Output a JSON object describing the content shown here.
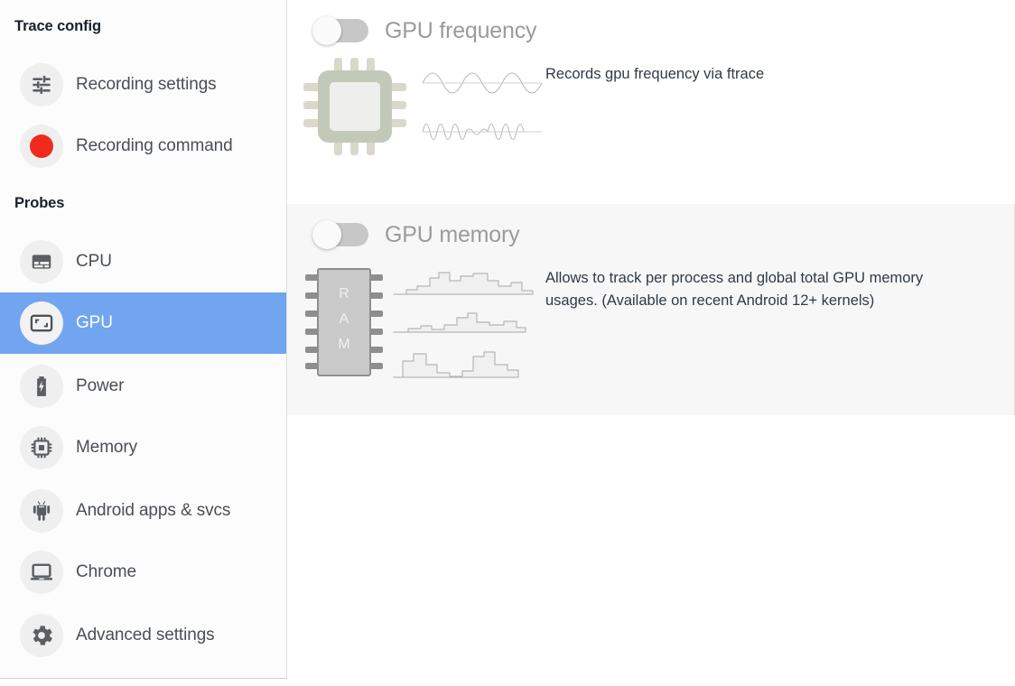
{
  "sidebar": {
    "headings": {
      "trace_config": "Trace config",
      "probes": "Probes"
    },
    "items": [
      {
        "label": "Recording settings",
        "icon": "tune-icon",
        "selected": false,
        "group": "trace"
      },
      {
        "label": "Recording command",
        "icon": "record-dot-icon",
        "selected": false,
        "group": "trace"
      },
      {
        "label": "CPU",
        "icon": "cpu-icon",
        "selected": false,
        "group": "probes"
      },
      {
        "label": "GPU",
        "icon": "gpu-icon",
        "selected": true,
        "group": "probes"
      },
      {
        "label": "Power",
        "icon": "battery-icon",
        "selected": false,
        "group": "probes"
      },
      {
        "label": "Memory",
        "icon": "memory-chip-icon",
        "selected": false,
        "group": "probes"
      },
      {
        "label": "Android apps & svcs",
        "icon": "android-icon",
        "selected": false,
        "group": "probes"
      },
      {
        "label": "Chrome",
        "icon": "laptop-icon",
        "selected": false,
        "group": "probes"
      },
      {
        "label": "Advanced settings",
        "icon": "gear-icon",
        "selected": false,
        "group": "probes"
      }
    ]
  },
  "main": {
    "probes": [
      {
        "title": "GPU frequency",
        "description": "Records gpu frequency via ftrace",
        "toggle_state": "off",
        "illustration": "cpu-chip-waveforms-illustration"
      },
      {
        "title": "GPU memory",
        "description": "Allows to track per process and global total GPU memory usages. (Available on recent Android 12+ kernels)",
        "toggle_state": "off",
        "illustration": "ram-stick-area-charts-illustration"
      }
    ]
  },
  "colors": {
    "selection_blue": "#72a5ef",
    "record_red": "#f02b1d",
    "icon_grey": "#5b5f63",
    "panel_shade": "#f7f7f7",
    "toggle_track": "#c7c7c7"
  }
}
